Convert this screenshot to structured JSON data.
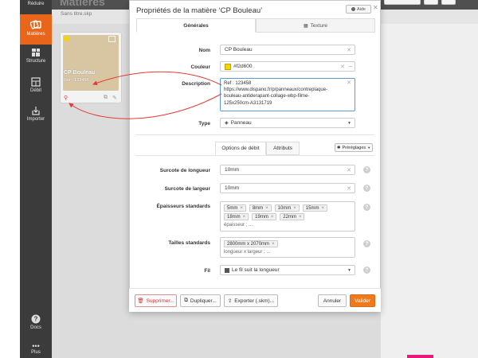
{
  "sidebar": {
    "items": [
      {
        "label": "Réduire",
        "icon": "collapse-icon"
      },
      {
        "label": "Matières",
        "icon": "materials-icon"
      },
      {
        "label": "Structure",
        "icon": "structure-icon"
      },
      {
        "label": "Débit",
        "icon": "cutting-icon"
      },
      {
        "label": "Importer",
        "icon": "import-icon"
      },
      {
        "label": "Docs",
        "icon": "help-icon"
      },
      {
        "label": "Plus",
        "icon": "more-icon"
      }
    ]
  },
  "background": {
    "page_title": "Matières",
    "tab": "Sans titre.skp"
  },
  "card": {
    "name": "CP Bouleau",
    "ref": "Ref : 123458"
  },
  "dialog": {
    "title": "Propriétés de la matière ‘CP Bouleau’",
    "help_label": "Aide",
    "tabs": {
      "general": "Générales",
      "texture": "Texture"
    },
    "fields": {
      "nom_label": "Nom",
      "nom_value": "CP Bouleau",
      "couleur_label": "Couleur",
      "couleur_value": "#f2d600",
      "description_label": "Description",
      "description_lines": [
        "Ref : 123458",
        "https://www.dispano.fr/p/panneaux/contreplaque-",
        "bouleau-antiderapant-collage-wbp-filme-",
        "125x250cm-A3131719"
      ],
      "type_label": "Type",
      "type_value": "Panneau"
    },
    "subtabs": {
      "debit": "Options de débit",
      "attributs": "Attributs",
      "presets": "Préréglages"
    },
    "debit": {
      "surcote_longueur_label": "Surcote de longueur",
      "surcote_longueur_value": "10mm",
      "surcote_largeur_label": "Surcote de largeur",
      "surcote_largeur_value": "10mm",
      "epaisseurs_label": "Épaisseurs standards",
      "epaisseurs": [
        "5mm",
        "8mm",
        "10mm",
        "15mm",
        "18mm",
        "19mm",
        "22mm"
      ],
      "epaisseurs_placeholder": "épaisseur ; ...",
      "tailles_label": "Tailles standards",
      "tailles": [
        "2800mm x 2070mm"
      ],
      "tailles_placeholder": "longueur x largeur ; ...",
      "fil_label": "Fil",
      "fil_value": "Le fil suit la longueur"
    },
    "footer": {
      "delete": "Supprimer...",
      "duplicate": "Dupliquer...",
      "export": "Exporter (.skm)...",
      "cancel": "Annuler",
      "validate": "Valider"
    }
  },
  "colors": {
    "accent": "#ef7a1e",
    "sidebar": "#3b3b3b",
    "material": "#f2d600",
    "annotation": "#e53935"
  }
}
